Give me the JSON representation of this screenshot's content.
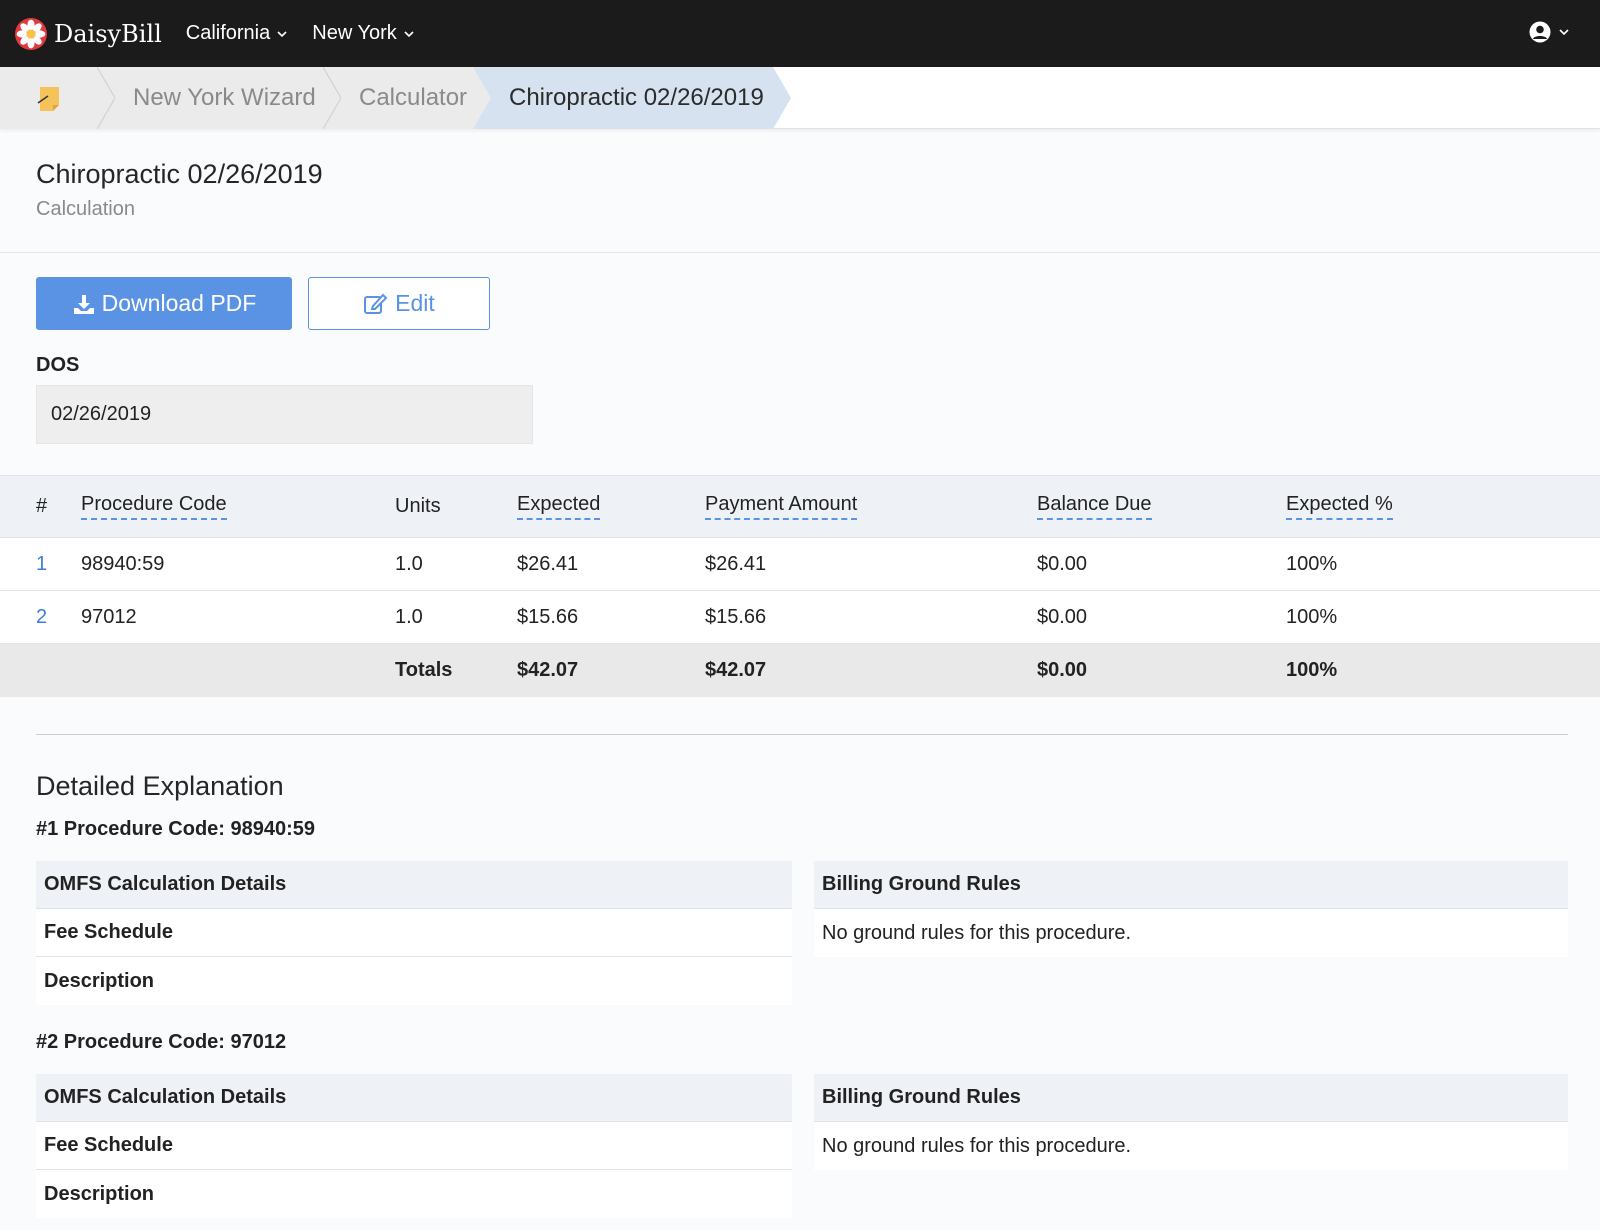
{
  "nav": {
    "brand": "DaisyBill",
    "items": [
      {
        "label": "California"
      },
      {
        "label": "New York"
      }
    ]
  },
  "breadcrumb": {
    "items": [
      "New York Wizard",
      "Calculator",
      "Chiropractic 02/26/2019"
    ]
  },
  "header": {
    "title": "Chiropractic 02/26/2019",
    "subtitle": "Calculation"
  },
  "actions": {
    "download_label": "Download PDF",
    "edit_label": "Edit"
  },
  "dos": {
    "label": "DOS",
    "value": "02/26/2019"
  },
  "table": {
    "columns": [
      "#",
      "Procedure Code",
      "Units",
      "Expected",
      "Payment Amount",
      "Balance Due",
      "Expected %"
    ],
    "rows": [
      {
        "num": "1",
        "code": "98940:59",
        "units": "1.0",
        "expected": "$26.41",
        "payment": "$26.41",
        "balance": "$0.00",
        "pct": "100%"
      },
      {
        "num": "2",
        "code": "97012",
        "units": "1.0",
        "expected": "$15.66",
        "payment": "$15.66",
        "balance": "$0.00",
        "pct": "100%"
      }
    ],
    "totals": {
      "label": "Totals",
      "expected": "$42.07",
      "payment": "$42.07",
      "balance": "$0.00",
      "pct": "100%"
    }
  },
  "detailed": {
    "title": "Detailed Explanation",
    "procedures": [
      {
        "title": "#1 Procedure Code: 98940:59",
        "left_head": "OMFS Calculation Details",
        "fee_schedule": "Fee Schedule",
        "description": "Description",
        "right_head": "Billing Ground Rules",
        "rules": "No ground rules for this procedure."
      },
      {
        "title": "#2 Procedure Code: 97012",
        "left_head": "OMFS Calculation Details",
        "fee_schedule": "Fee Schedule",
        "description": "Description",
        "right_head": "Billing Ground Rules",
        "rules": "No ground rules for this procedure."
      }
    ]
  },
  "colors": {
    "topbar": "#1b1b1b",
    "accent": "#5b93e4",
    "active_crumb": "#d6e2f0",
    "brand_logo": "#e0393e"
  },
  "icons": [
    "daisy-logo-icon",
    "chevron-down-icon",
    "user-circle-icon",
    "sticky-note-icon",
    "download-icon",
    "edit-icon"
  ]
}
